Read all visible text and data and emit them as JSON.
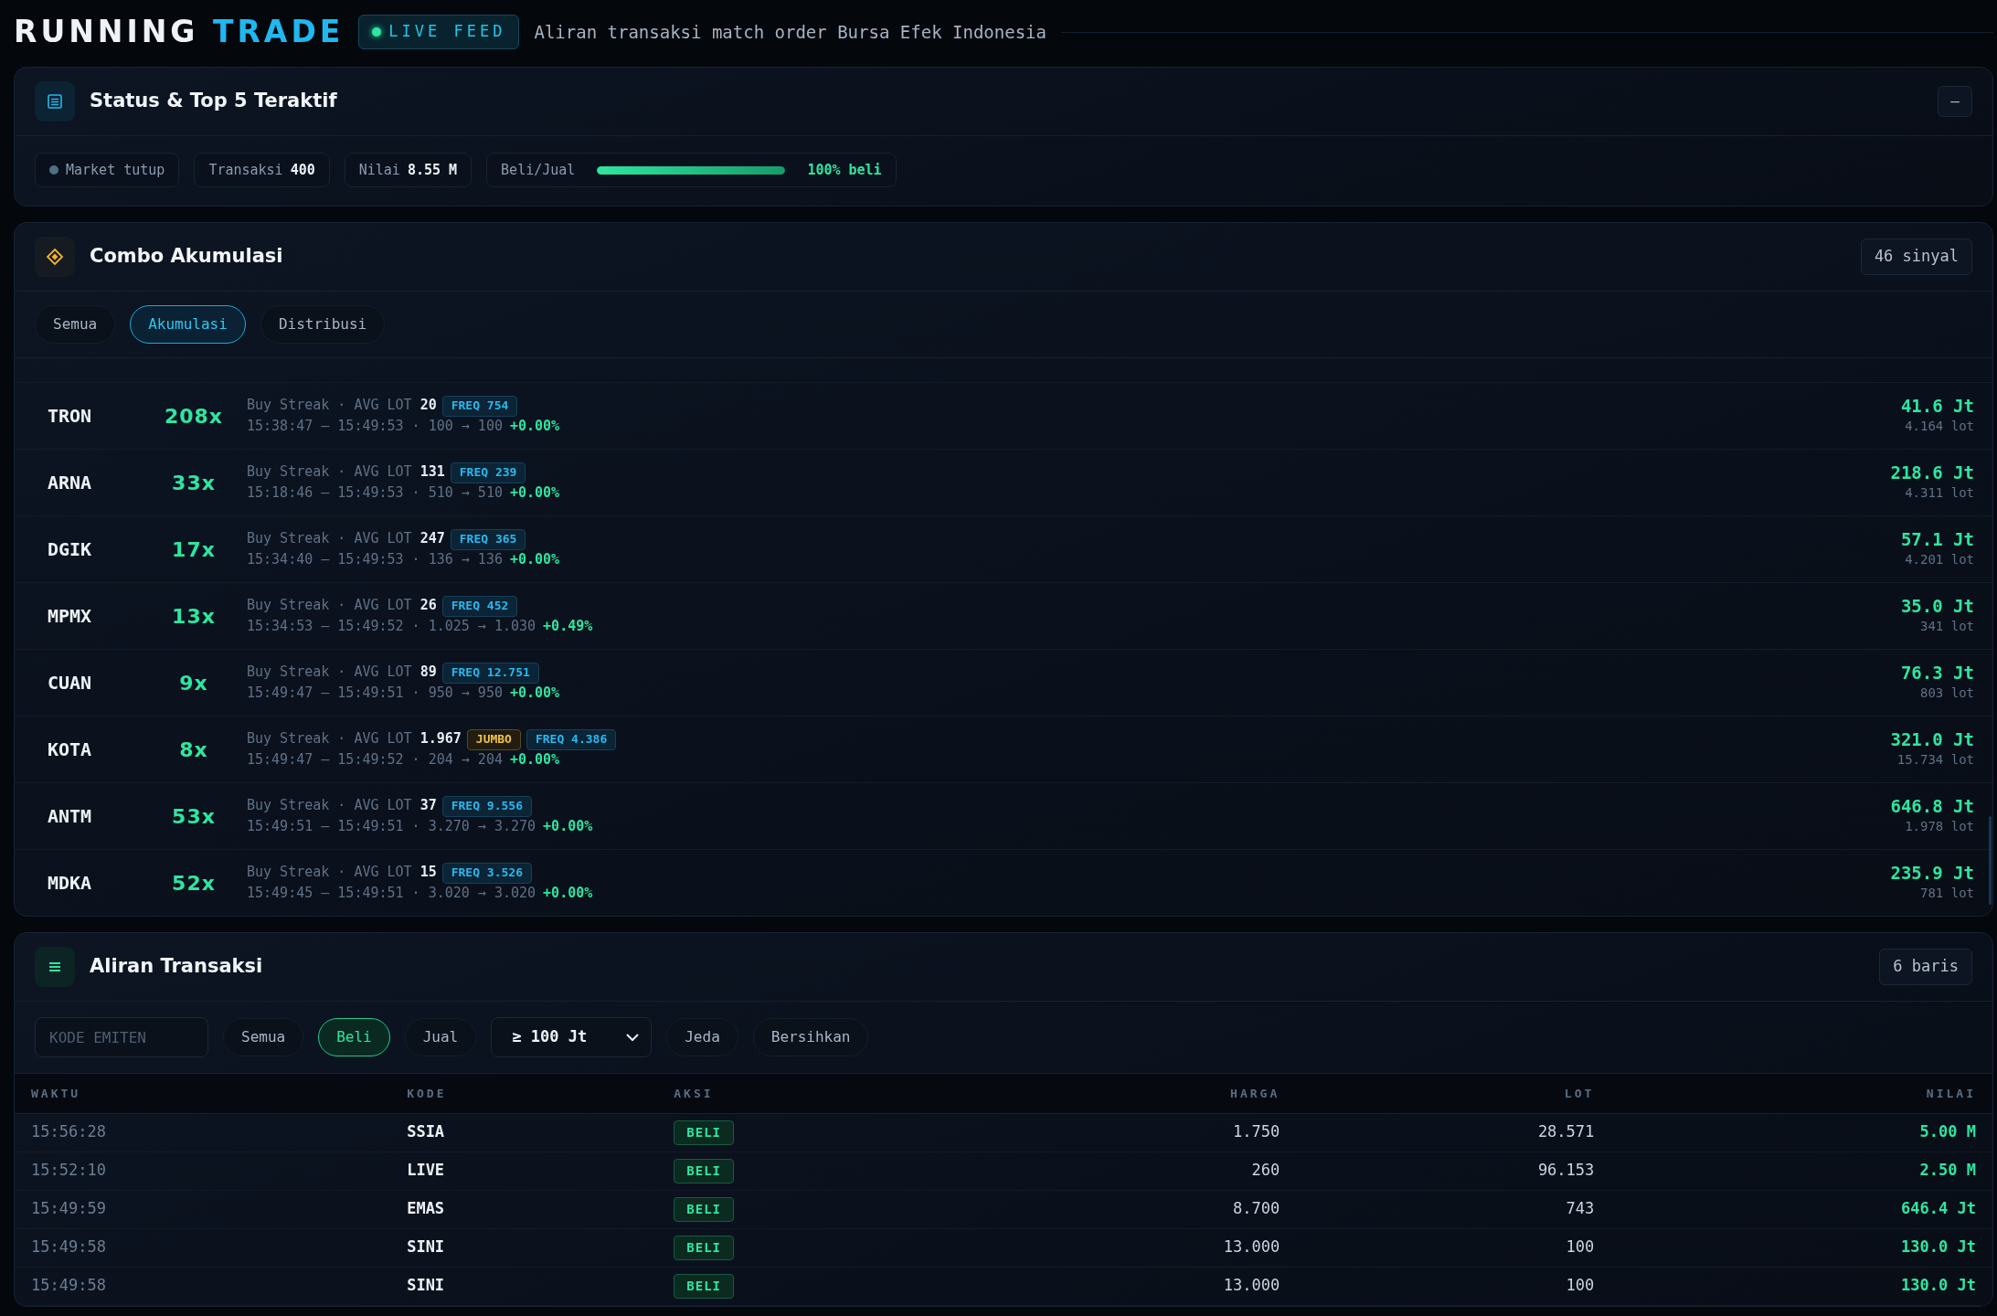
{
  "header": {
    "title_main": "RUNNING",
    "title_accent": "TRADE",
    "live_badge": {
      "text": "LIVE FEED",
      "live": true
    },
    "subtitle": "Aliran transaksi match order Bursa Efek Indonesia"
  },
  "status_panel": {
    "title": "Status & Top 5 Teraktif",
    "collapse_button": "–",
    "market": {
      "text": "Market tutup",
      "open": false
    },
    "stats": [
      {
        "label": "Transaksi",
        "value": "400"
      },
      {
        "label": "Nilai",
        "value": "8.55 M"
      }
    ],
    "ratio": {
      "label": "Beli/Jual",
      "level": 1,
      "reading": "100% beli"
    }
  },
  "combo_panel": {
    "title": "Combo Akumulasi",
    "count": "46 sinyal",
    "tabs": [
      {
        "label": "Semua",
        "selected": false
      },
      {
        "label": "Akumulasi",
        "selected": true
      },
      {
        "label": "Distribusi",
        "selected": false
      }
    ],
    "signals": [
      {
        "ticker": "TRON",
        "multiple": "208x",
        "label": "Buy Streak · AVG LOT",
        "avg_lot": "20",
        "tags": [
          {
            "kind": "freq",
            "text": "FREQ 754"
          }
        ],
        "range": "15:38:47 – 15:49:53 · 100 → 100",
        "change": "+0.00%",
        "value": "41.6 Jt",
        "lot": "4.164 lot"
      },
      {
        "ticker": "ARNA",
        "multiple": "33x",
        "label": "Buy Streak · AVG LOT",
        "avg_lot": "131",
        "tags": [
          {
            "kind": "freq",
            "text": "FREQ 239"
          }
        ],
        "range": "15:18:46 – 15:49:53 · 510 → 510",
        "change": "+0.00%",
        "value": "218.6 Jt",
        "lot": "4.311 lot"
      },
      {
        "ticker": "DGIK",
        "multiple": "17x",
        "label": "Buy Streak · AVG LOT",
        "avg_lot": "247",
        "tags": [
          {
            "kind": "freq",
            "text": "FREQ 365"
          }
        ],
        "range": "15:34:40 – 15:49:53 · 136 → 136",
        "change": "+0.00%",
        "value": "57.1 Jt",
        "lot": "4.201 lot"
      },
      {
        "ticker": "MPMX",
        "multiple": "13x",
        "label": "Buy Streak · AVG LOT",
        "avg_lot": "26",
        "tags": [
          {
            "kind": "freq",
            "text": "FREQ 452"
          }
        ],
        "range": "15:34:53 – 15:49:52 · 1.025 → 1.030",
        "change": "+0.49%",
        "value": "35.0 Jt",
        "lot": "341 lot"
      },
      {
        "ticker": "CUAN",
        "multiple": "9x",
        "label": "Buy Streak · AVG LOT",
        "avg_lot": "89",
        "tags": [
          {
            "kind": "freq",
            "text": "FREQ 12.751"
          }
        ],
        "range": "15:49:47 – 15:49:51 · 950 → 950",
        "change": "+0.00%",
        "value": "76.3 Jt",
        "lot": "803 lot"
      },
      {
        "ticker": "KOTA",
        "multiple": "8x",
        "label": "Buy Streak · AVG LOT",
        "avg_lot": "1.967",
        "tags": [
          {
            "kind": "jumbo",
            "text": "JUMBO"
          },
          {
            "kind": "freq",
            "text": "FREQ 4.386"
          }
        ],
        "range": "15:49:47 – 15:49:52 · 204 → 204",
        "change": "+0.00%",
        "value": "321.0 Jt",
        "lot": "15.734 lot"
      },
      {
        "ticker": "ANTM",
        "multiple": "53x",
        "label": "Buy Streak · AVG LOT",
        "avg_lot": "37",
        "tags": [
          {
            "kind": "freq",
            "text": "FREQ 9.556"
          }
        ],
        "range": "15:49:51 – 15:49:51 · 3.270 → 3.270",
        "change": "+0.00%",
        "value": "646.8 Jt",
        "lot": "1.978 lot"
      },
      {
        "ticker": "MDKA",
        "multiple": "52x",
        "label": "Buy Streak · AVG LOT",
        "avg_lot": "15",
        "tags": [
          {
            "kind": "freq",
            "text": "FREQ 3.526"
          }
        ],
        "range": "15:49:45 – 15:49:51 · 3.020 → 3.020",
        "change": "+0.00%",
        "value": "235.9 Jt",
        "lot": "781 lot"
      }
    ]
  },
  "flow_panel": {
    "title": "Aliran Transaksi",
    "count": "6 baris",
    "search": {
      "placeholder": "KODE EMITEN"
    },
    "side_filters": [
      {
        "label": "Semua",
        "selected": false
      },
      {
        "label": "Beli",
        "selected": true
      },
      {
        "label": "Jual",
        "selected": false
      }
    ],
    "threshold": "≥ 100 Jt",
    "actions": [
      "Jeda",
      "Bersihkan"
    ],
    "table": {
      "columns": [
        "WAKTU",
        "KODE",
        "AKSI",
        "HARGA",
        "LOT",
        "NILAI"
      ],
      "rows": [
        {
          "time": "15:56:28",
          "code": "SSIA",
          "action": {
            "text": "BELI",
            "kind": "buy"
          },
          "price": "1.750",
          "lot": "28.571",
          "value": "5.00 M"
        },
        {
          "time": "15:52:10",
          "code": "LIVE",
          "action": {
            "text": "BELI",
            "kind": "buy"
          },
          "price": "260",
          "lot": "96.153",
          "value": "2.50 M"
        },
        {
          "time": "15:49:59",
          "code": "EMAS",
          "action": {
            "text": "BELI",
            "kind": "buy"
          },
          "price": "8.700",
          "lot": "743",
          "value": "646.4 Jt"
        },
        {
          "time": "15:49:58",
          "code": "SINI",
          "action": {
            "text": "BELI",
            "kind": "buy"
          },
          "price": "13.000",
          "lot": "100",
          "value": "130.0 Jt"
        },
        {
          "time": "15:49:58",
          "code": "SINI",
          "action": {
            "text": "BELI",
            "kind": "buy"
          },
          "price": "13.000",
          "lot": "100",
          "value": "130.0 Jt"
        }
      ]
    }
  }
}
